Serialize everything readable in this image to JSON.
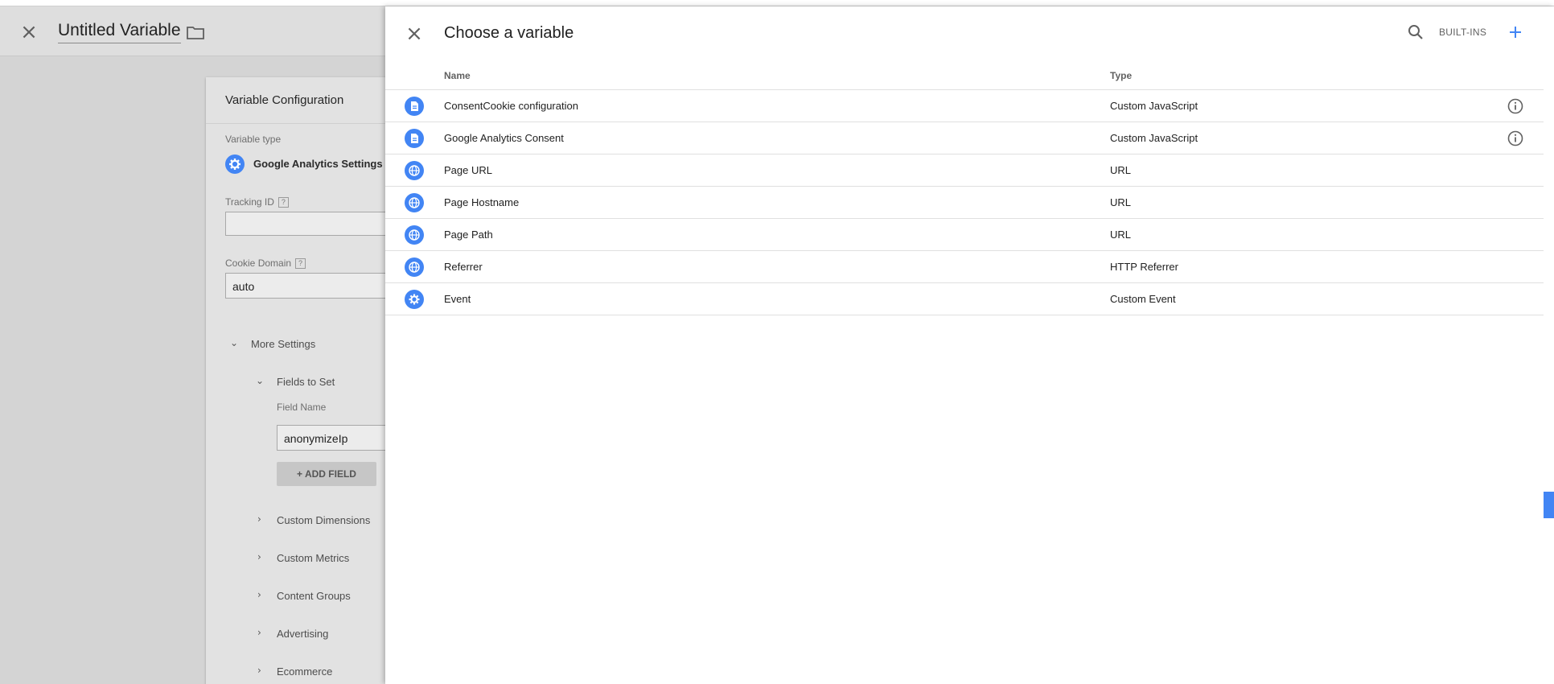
{
  "background": {
    "title": "Untitled Variable",
    "card": {
      "title": "Variable Configuration",
      "variable_type_label": "Variable type",
      "variable_type_value": "Google Analytics Settings",
      "tracking_id_label": "Tracking ID",
      "tracking_id_value": "",
      "cookie_domain_label": "Cookie Domain",
      "cookie_domain_value": "auto",
      "help_glyph": "?",
      "more_settings": "More Settings",
      "fields_to_set": "Fields to Set",
      "field_name_label": "Field Name",
      "field_name_value": "anonymizeIp",
      "add_field": "+ ADD FIELD",
      "sections": [
        "Custom Dimensions",
        "Custom Metrics",
        "Content Groups",
        "Advertising",
        "Ecommerce"
      ]
    }
  },
  "panel": {
    "title": "Choose a variable",
    "builtins_label": "BUILT-INS",
    "columns": {
      "name": "Name",
      "type": "Type"
    },
    "rows": [
      {
        "name": "ConsentCookie configuration",
        "type": "Custom JavaScript",
        "icon": "document-icon",
        "info": true
      },
      {
        "name": "Google Analytics Consent",
        "type": "Custom JavaScript",
        "icon": "document-icon",
        "info": true
      },
      {
        "name": "Page URL",
        "type": "URL",
        "icon": "globe-icon",
        "info": false
      },
      {
        "name": "Page Hostname",
        "type": "URL",
        "icon": "globe-icon",
        "info": false
      },
      {
        "name": "Page Path",
        "type": "URL",
        "icon": "globe-icon",
        "info": false
      },
      {
        "name": "Referrer",
        "type": "HTTP Referrer",
        "icon": "globe-icon",
        "info": false
      },
      {
        "name": "Event",
        "type": "Custom Event",
        "icon": "gear-icon",
        "info": false
      }
    ]
  },
  "colors": {
    "accent": "#4285f4",
    "overlay_bg": "#d4d4d4",
    "panel_bg": "#ffffff"
  }
}
